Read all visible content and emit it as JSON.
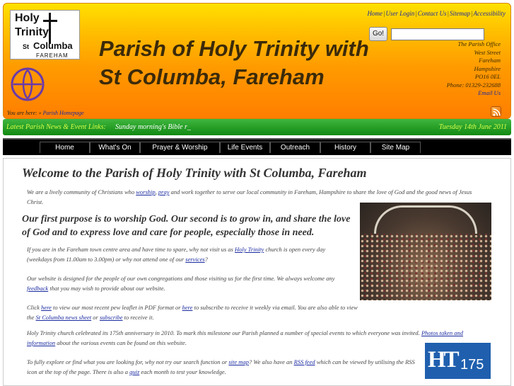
{
  "header": {
    "logo": {
      "line1": "Holy",
      "line2": "Trinity",
      "line3_small": "St",
      "line3": "Columba",
      "line4": "FAREHAM"
    },
    "site_title": "Parish of Holy Trinity with St Columba, Fareham",
    "top_links": [
      "Home",
      "User Login",
      "Contact Us",
      "Sitemap",
      "Accessibility"
    ],
    "search": {
      "button_label": "Go!",
      "value": ""
    },
    "address": [
      "The Parish Office",
      "West Street",
      "Fareham",
      "Hampshire",
      "PO16 0EL",
      "Phone: 01329-232688"
    ],
    "email_label": "Email Us",
    "breadcrumb": {
      "prefix": "You are here: » ",
      "current": "Parish Homepage"
    }
  },
  "news": {
    "label": "Latest Parish News & Event Links:",
    "ticker": "Sunday morning's Bible r_",
    "date": "Tuesday 14th June 2011"
  },
  "nav": [
    "Home",
    "What's On",
    "Prayer & Worship",
    "Life Events",
    "Outreach",
    "History",
    "Site Map"
  ],
  "main": {
    "title": "Welcome to the Parish of Holy Trinity with St Columba, Fareham",
    "intro": {
      "t1": "We are a lively community of Christians who ",
      "link1": "worship",
      "t2": ", ",
      "link2": "pray",
      "t3": " and work together to serve our local community in Fareham, Hampshire to share the love of God and the good news of Jesus Christ."
    },
    "purpose": "Our first purpose is to worship God. Our second is to grow in, and share the love of God and to express love and care for people, especially those in need.",
    "visit": {
      "t1": "If you are in the Fareham town centre area and have time to spare, why not visit us as ",
      "link1": "Holy Trinity",
      "t2": " church is open every day (weekdays from 11.00am to 3.00pm) or why not attend one of our ",
      "link2": "services",
      "t3": "?"
    },
    "website": {
      "t1": "Our website is designed for the people of our own congregations and those visiting us for the first time. We always welcome any ",
      "link1": "feedback",
      "t2": " that you may wish to provide about our website."
    },
    "pew": {
      "t1": "Click ",
      "link1": "here",
      "t2": " to view our most recent pew leaflet in PDF format or ",
      "link2": "here",
      "t3": " to subscribe to receive it weekly via email. You are also able to view the ",
      "link3": "St Columba news sheet",
      "t4": " or ",
      "link4": "subscribe",
      "t5": " to receive it."
    },
    "anniversary": {
      "t1": "Holy Trinity church celebrated its 175th anniversary in 2010. To mark this milestone our Parish planned a number of special events to which everyone was invited. ",
      "link1": "Photos taken and information",
      "t2": " about the various events can be found on this website."
    },
    "explore": {
      "t1": "To fully explore or find what you are looking for, why not try our search function or ",
      "link1": "site map",
      "t2": "? We also have an ",
      "link2": "RSS feed",
      "t3": " which can be viewed by utilising the RSS icon at the top of the page. There is also a ",
      "link3": "quiz",
      "t4": " each month to test your knowledge."
    },
    "anniversary_logo": {
      "letters": "HT",
      "number": "175"
    }
  },
  "colors": {
    "header_top": "#ffe100",
    "header_bottom": "#ff7e00",
    "news_bar": "#1f9a1f",
    "link": "#1a2aa0",
    "logo_175_bg": "#1f5fae"
  },
  "icons": [
    "search-icon",
    "rss-icon",
    "cross-icon",
    "church-emblem-icon"
  ]
}
